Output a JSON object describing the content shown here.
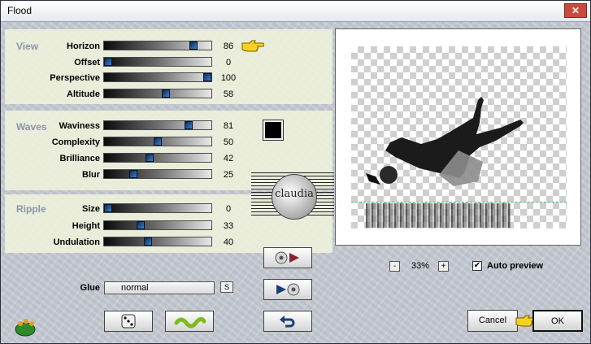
{
  "window": {
    "title": "Flood",
    "close_symbol": "✕"
  },
  "sections": {
    "view": "View",
    "waves": "Waves",
    "ripple": "Ripple"
  },
  "params": [
    {
      "key": "horizon",
      "label": "Horizon",
      "value": 86
    },
    {
      "key": "offset",
      "label": "Offset",
      "value": 0
    },
    {
      "key": "perspective",
      "label": "Perspective",
      "value": 100
    },
    {
      "key": "altitude",
      "label": "Altitude",
      "value": 58
    },
    {
      "key": "waviness",
      "label": "Waviness",
      "value": 81
    },
    {
      "key": "complexity",
      "label": "Complexity",
      "value": 50
    },
    {
      "key": "brilliance",
      "label": "Brilliance",
      "value": 42
    },
    {
      "key": "blur",
      "label": "Blur",
      "value": 25
    },
    {
      "key": "size",
      "label": "Size",
      "value": 0
    },
    {
      "key": "height",
      "label": "Height",
      "value": 33
    },
    {
      "key": "undulation",
      "label": "Undulation",
      "value": 40
    }
  ],
  "slider_max": 100,
  "wave_color": "#000000",
  "watermark": {
    "text": "claudia"
  },
  "preview": {
    "zoom": "33%",
    "zoom_out": "-",
    "zoom_in": "+",
    "auto_preview_label": "Auto preview",
    "auto_preview_checked": true,
    "check_symbol": "✔"
  },
  "glue": {
    "label": "Glue",
    "value": "normal",
    "button": "S"
  },
  "buttons": {
    "cancel": "Cancel",
    "ok": "OK"
  },
  "icons": {
    "frog": "frog-logo-icon",
    "dice": "dice-icon",
    "wave": "wave-icon",
    "preview_play": "preview-play-icon",
    "play_preview": "play-preview-icon",
    "undo": "undo-icon",
    "hand": "pointing-hand-icon"
  }
}
